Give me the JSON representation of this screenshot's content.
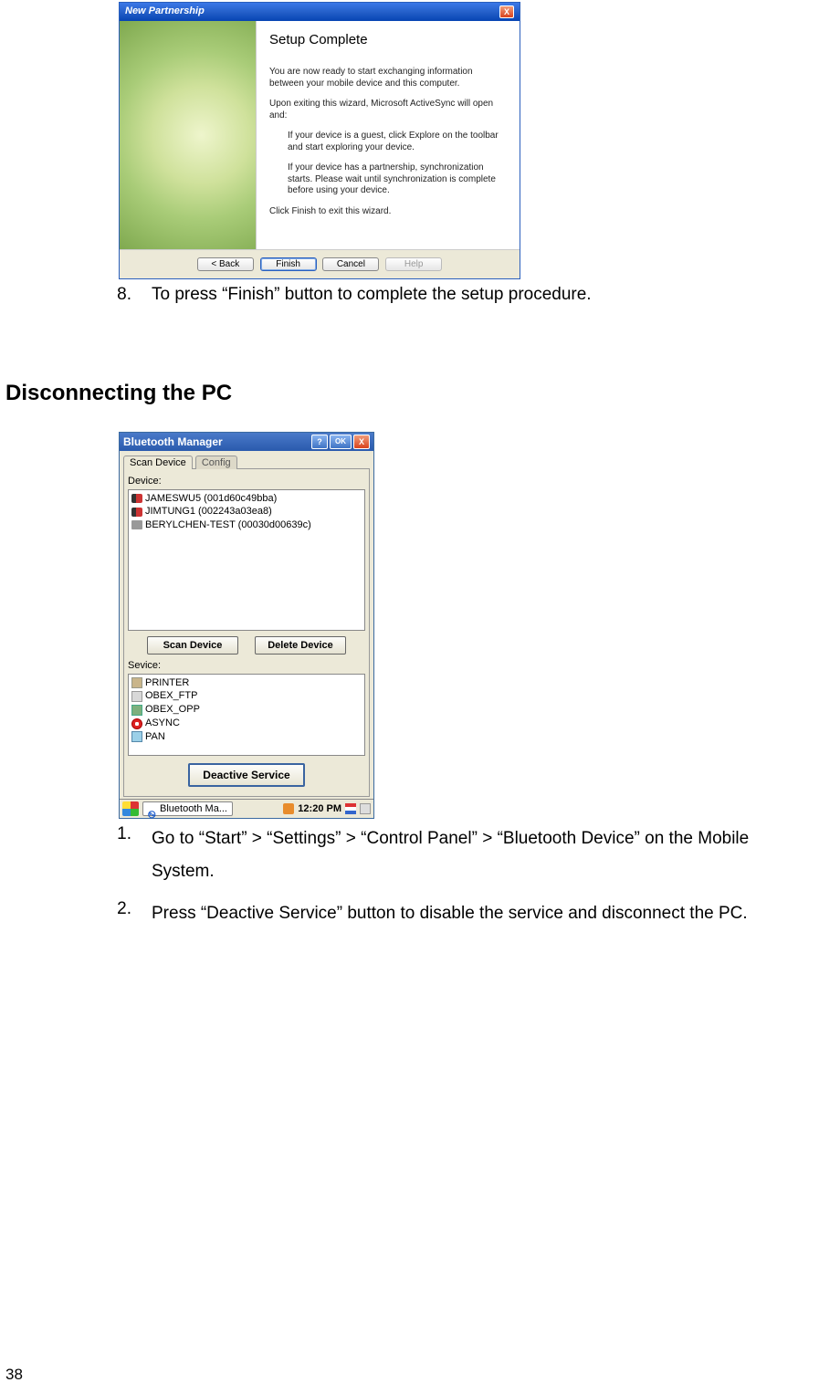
{
  "wizard": {
    "title": "New Partnership",
    "heading": "Setup Complete",
    "p1": "You are now ready to start exchanging information between your mobile device and this computer.",
    "p2": "Upon exiting this wizard, Microsoft ActiveSync will open and:",
    "b1": "If your device is a guest, click Explore on the toolbar and start exploring your device.",
    "b2": "If your device has a partnership, synchronization starts. Please wait until synchronization is complete before using your device.",
    "p3": "Click Finish to exit this wizard.",
    "btn_back": "< Back",
    "btn_finish": "Finish",
    "btn_cancel": "Cancel",
    "btn_help": "Help"
  },
  "step8_num": "8.",
  "step8_text": "To press “Finish” button to complete the setup procedure.",
  "section_title": "Disconnecting the PC",
  "bt": {
    "title": "Bluetooth Manager",
    "help": "?",
    "ok": "OK",
    "close": "X",
    "tab_scan": "Scan Device",
    "tab_config": "Config",
    "label_device": "Device:",
    "devices": [
      "JAMESWU5 (001d60c49bba)",
      "JIMTUNG1 (002243a03ea8)",
      "BERYLCHEN-TEST (00030d00639c)"
    ],
    "btn_scan": "Scan Device",
    "btn_delete": "Delete Device",
    "label_service": "Sevice:",
    "services": [
      "PRINTER",
      "OBEX_FTP",
      "OBEX_OPP",
      "ASYNC",
      "PAN"
    ],
    "btn_deactive": "Deactive Service",
    "task_app": "Bluetooth Ma...",
    "time": "12:20 PM"
  },
  "step1_num": "1.",
  "step1_text": "Go to “Start” > “Settings” > “Control Panel” > “Bluetooth Device” on the Mobile System.",
  "step2_num": "2.",
  "step2_text": "Press “Deactive Service” button to disable the service and disconnect the PC.",
  "page_number": "38"
}
